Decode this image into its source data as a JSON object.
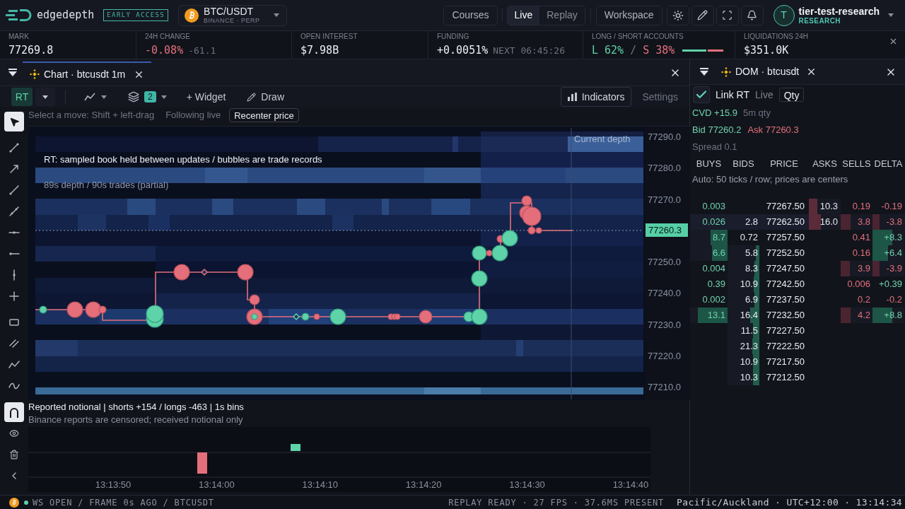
{
  "header": {
    "brand": "edgedepth",
    "badge": "EARLY ACCESS",
    "symbol": {
      "pair": "BTC/USDT",
      "venue": "BINANCE · PERP"
    },
    "courses": "Courses",
    "modes": [
      {
        "label": "Live",
        "selected": true
      },
      {
        "label": "Replay",
        "selected": false
      }
    ],
    "workspace": "Workspace",
    "user": {
      "initial": "T",
      "name": "tier-test-research",
      "plan": "RESEARCH"
    }
  },
  "stats": [
    {
      "kind": "value",
      "label": "MARK",
      "value": "77269.8"
    },
    {
      "kind": "down",
      "label": "24H CHANGE",
      "value": "-0.08%",
      "note": "-61.1"
    },
    {
      "kind": "value",
      "label": "OPEN INTEREST",
      "value": "$7.98B"
    },
    {
      "kind": "value",
      "label": "FUNDING",
      "value": "+0.0051%",
      "note": "NEXT 06:45:26"
    },
    {
      "kind": "ratio",
      "label": "LONG / SHORT ACCOUNTS",
      "long": "L 62%",
      "separator": "/",
      "short": "S 38%",
      "level": 0.62
    },
    {
      "kind": "value",
      "label": "LIQUIDATIONS 24H",
      "value": "$351.0K"
    }
  ],
  "chart_panel": {
    "tab": {
      "title": "Chart · btcusdt 1m",
      "selected": true
    },
    "toolbar": {
      "mode": "RT",
      "layer_count": "2",
      "widget": "+ Widget",
      "draw": "Draw",
      "indicators": "Indicators",
      "settings": "Settings"
    },
    "tool_groups": [
      [
        {
          "kind": "pointer",
          "selected": true
        }
      ],
      [
        {
          "kind": "segment",
          "selected": false
        },
        {
          "kind": "arrow",
          "selected": false
        },
        {
          "kind": "ray",
          "selected": false
        },
        {
          "kind": "polyline",
          "selected": false
        },
        {
          "kind": "hline",
          "selected": false
        },
        {
          "kind": "hray",
          "selected": false
        },
        {
          "kind": "vline",
          "selected": false
        },
        {
          "kind": "cross",
          "selected": false
        }
      ],
      [
        {
          "kind": "rect",
          "selected": false
        },
        {
          "kind": "parallel",
          "selected": false
        },
        {
          "kind": "path",
          "selected": false
        },
        {
          "kind": "curve",
          "selected": false
        }
      ]
    ],
    "magnet": {
      "on": true
    },
    "hint": "Select a move: Shift + left-drag",
    "follow_status": "Following live",
    "recenter": "Recenter price",
    "overlay": {
      "title": "RT: sampled book held between updates / bubbles are trade records",
      "subtitle": "89s depth / 90s trades (partial)",
      "depth_label": "Current depth"
    },
    "price_axis": [
      {
        "kind": "tick",
        "label": "77290.0"
      },
      {
        "kind": "tick",
        "label": "77280.0"
      },
      {
        "kind": "tick",
        "label": "77270.0"
      },
      {
        "kind": "current",
        "label": "77260.3"
      },
      {
        "kind": "tick",
        "label": "77250.0"
      },
      {
        "kind": "tick",
        "label": "77240.0"
      },
      {
        "kind": "tick",
        "label": "77230.0"
      },
      {
        "kind": "tick",
        "label": "77220.0"
      },
      {
        "kind": "tick",
        "label": "77210.0"
      }
    ],
    "notional": {
      "title": "Reported notional | shorts +154 / longs -463 | 1s bins",
      "note": "Binance reports are censored; received notional only",
      "time_axis": [
        "13:13:50",
        "13:14:00",
        "13:14:10",
        "13:14:20",
        "13:14:30",
        "13:14:40"
      ]
    }
  },
  "dom_panel": {
    "title": "DOM · btcusdt",
    "link": {
      "label": "Link RT",
      "checked": true
    },
    "feed": "Live",
    "unit": "Qty",
    "cvd": "CVD +15.9",
    "cvd_window": "5m qty",
    "bid": "Bid 77260.2",
    "ask": "Ask 77260.3",
    "spread": "Spread 0.1",
    "columns": [
      "BUYS",
      "BIDS",
      "PRICE",
      "ASKS",
      "SELLS",
      "DELTA"
    ],
    "note": "Auto: 50 ticks / row; prices are centers",
    "rows": [
      {
        "highlighted": false,
        "buys": {
          "text": "0.003"
        },
        "price": "77267.50",
        "asks": {
          "text": "10.3",
          "level": 0.27
        },
        "sells": {
          "text": "0.19"
        },
        "delta": {
          "text": "-0.19",
          "kind": "negative"
        }
      },
      {
        "highlighted": true,
        "buys": {
          "text": "0.026"
        },
        "bids": {
          "text": "2.8"
        },
        "price": "77262.50",
        "asks": {
          "text": "16.0",
          "level": 0.38
        },
        "sells": {
          "text": "3.8",
          "level": 0.3
        },
        "delta": {
          "text": "-3.8",
          "kind": "negative",
          "level": 0.22
        }
      },
      {
        "highlighted": false,
        "buys": {
          "text": "8.7",
          "level": 0.45
        },
        "bids": {
          "text": "0.72"
        },
        "price": "77257.50",
        "sells": {
          "text": "0.41"
        },
        "delta": {
          "text": "+8.3",
          "kind": "positive",
          "level": 0.62
        }
      },
      {
        "highlighted": false,
        "buys": {
          "text": "6.6",
          "level": 0.42
        },
        "bids": {
          "text": "5.8",
          "level": 0.12
        },
        "price": "77252.50",
        "sells": {
          "text": "0.16"
        },
        "delta": {
          "text": "+6.4",
          "kind": "positive",
          "level": 0.48
        }
      },
      {
        "highlighted": false,
        "buys": {
          "text": "0.004"
        },
        "bids": {
          "text": "8.3",
          "level": 0.15
        },
        "price": "77247.50",
        "sells": {
          "text": "3.9",
          "level": 0.28
        },
        "delta": {
          "text": "-3.9",
          "kind": "negative",
          "level": 0.22
        }
      },
      {
        "highlighted": false,
        "buys": {
          "text": "0.39"
        },
        "bids": {
          "text": "10.9",
          "level": 0.18
        },
        "price": "77242.50",
        "sells": {
          "text": "0.006"
        },
        "delta": {
          "text": "+0.39",
          "kind": "positive"
        }
      },
      {
        "highlighted": false,
        "buys": {
          "text": "0.002"
        },
        "bids": {
          "text": "6.9",
          "level": 0.15
        },
        "price": "77237.50",
        "sells": {
          "text": "0.2"
        },
        "delta": {
          "text": "-0.2",
          "kind": "negative"
        }
      },
      {
        "highlighted": false,
        "buys": {
          "text": "13.1",
          "level": 0.8
        },
        "bids": {
          "text": "16.4",
          "level": 0.3
        },
        "price": "77232.50",
        "sells": {
          "text": "4.2",
          "level": 0.3
        },
        "delta": {
          "text": "+8.8",
          "kind": "positive",
          "level": 0.62
        }
      },
      {
        "highlighted": false,
        "bids": {
          "text": "11.5",
          "level": 0.2
        },
        "price": "77227.50"
      },
      {
        "highlighted": false,
        "bids": {
          "text": "21.3",
          "level": 0.22
        },
        "price": "77222.50"
      },
      {
        "highlighted": false,
        "bids": {
          "text": "10.9",
          "level": 0.2
        },
        "price": "77217.50"
      },
      {
        "highlighted": false,
        "bids": {
          "text": "10.3",
          "level": 0.2
        },
        "price": "77212.50"
      }
    ]
  },
  "status_bar": {
    "connection": "WS OPEN / FRAME 0s AGO / BTCUSDT",
    "performance": "REPLAY READY · 27 FPS · 37.6MS PRESENT",
    "clock": "Pacific/Auckland · UTC+12:00 · 13:14:34"
  }
}
